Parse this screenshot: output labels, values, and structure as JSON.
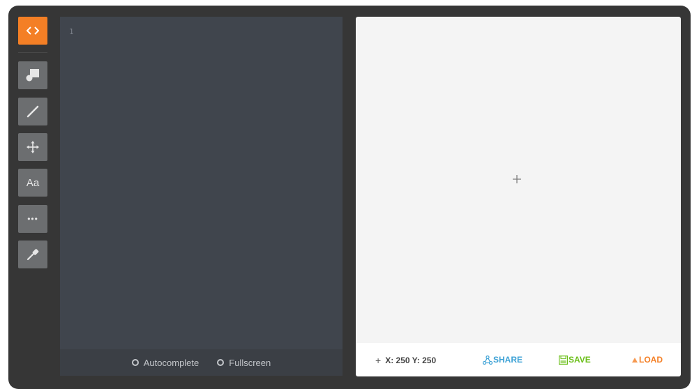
{
  "sidebar": {
    "tools": [
      {
        "name": "code",
        "icon": "code-icon"
      },
      {
        "name": "shapes",
        "icon": "shapes-icon"
      },
      {
        "name": "line",
        "icon": "line-icon"
      },
      {
        "name": "move",
        "icon": "move-icon"
      },
      {
        "name": "text",
        "icon": "text-icon",
        "label": "Aa"
      },
      {
        "name": "more",
        "icon": "more-icon",
        "label": "•••"
      },
      {
        "name": "eyedropper",
        "icon": "eyedropper-icon"
      }
    ]
  },
  "editor": {
    "line_number": "1",
    "options": {
      "autocomplete": "Autocomplete",
      "fullscreen": "Fullscreen"
    }
  },
  "canvas": {
    "coords_label": "X: 250 Y: 250",
    "share_label": "SHARE",
    "save_label": "SAVE",
    "load_label": "LOAD"
  },
  "colors": {
    "accent": "#f47f25",
    "share": "#3ea2d6",
    "save": "#6cbf1b",
    "load": "#f47f25",
    "frame": "#363636",
    "editor": "#40454d"
  }
}
